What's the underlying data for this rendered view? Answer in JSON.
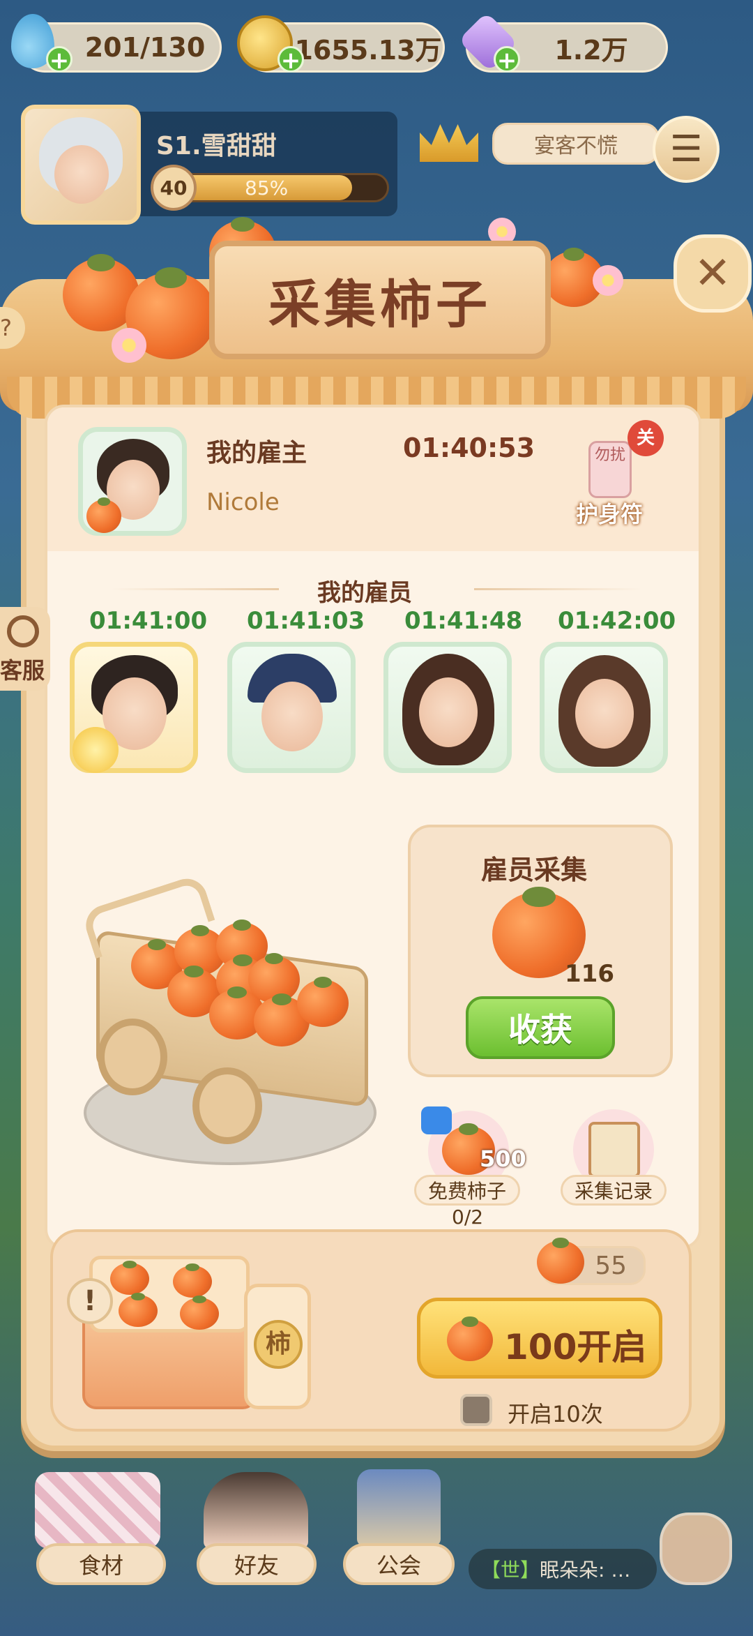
{
  "resources": {
    "water": "201/130",
    "gold": "1655.13万",
    "gem": "1.2万"
  },
  "player": {
    "name": "S1.雪甜甜",
    "level": "40",
    "progress_label": "85%",
    "progress_fraction": 0.85,
    "status_banner": "宴客不慌"
  },
  "panel": {
    "title": "采集柿子",
    "employer_label": "我的雇主",
    "employer_name": "Nicole",
    "employer_timer": "01:40:53",
    "amulet_label": "护身符",
    "amulet_badge": "关",
    "amulet_tag": "勿扰",
    "employees_label": "我的雇员",
    "employees": [
      {
        "timer": "01:41:00"
      },
      {
        "timer": "01:41:03"
      },
      {
        "timer": "01:41:48"
      },
      {
        "timer": "01:42:00"
      }
    ],
    "collect_title": "雇员采集",
    "collect_count": "116",
    "harvest_label": "收获",
    "free_label": "免费柿子",
    "free_amount": "500",
    "free_quota": "0/2",
    "record_label": "采集记录",
    "box_char": "柿",
    "owned_count": "55",
    "open_label": "100开启",
    "open_ten_label": "开启10次"
  },
  "side": {
    "service_label": "客服"
  },
  "nav": {
    "items": [
      "食材",
      "好友",
      "公会"
    ],
    "chat_channel": "【世】",
    "chat_text": "眠朵朵: …"
  },
  "colors": {
    "accent_green": "#6cbf30",
    "accent_gold": "#f2b83a",
    "timer_green": "#3a8c3a",
    "title_brown": "#7b3f26"
  }
}
